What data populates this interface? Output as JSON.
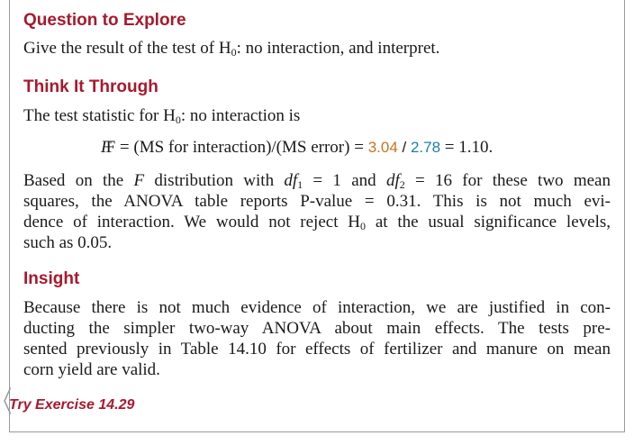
{
  "question": {
    "heading": "Question to Explore",
    "text_pre": "Give the result of the test of H",
    "text_sub": "0",
    "text_post": ": no interaction, and interpret."
  },
  "think": {
    "heading": "Think It Through",
    "intro_pre": "The test statistic for H",
    "intro_sub": "0",
    "intro_post": ": no interaction is",
    "formula_lhs": "F = (MS for interaction)/(MS error) = ",
    "ms_interaction": "3.04",
    "formula_slash": " / ",
    "ms_error": "2.78",
    "formula_result": " = 1.10.",
    "line1_pre": "Based on the ",
    "line1_F": "F",
    "line1_mid": " distribution with ",
    "df1_label": "df",
    "df1_sub": "1",
    "df1_val": " = 1 and ",
    "df2_label": "df",
    "df2_sub": "2",
    "df2_val": " = 16 for these two mean",
    "line2": "squares, the ANOVA table reports P-value = 0.31. This is not much evi-",
    "line3_pre": "dence of interaction. We would not reject H",
    "line3_sub": "0",
    "line3_post": " at the usual significance levels,",
    "line4": "such as 0.05."
  },
  "insight": {
    "heading": "Insight",
    "line1": "Because there is not much evidence of interaction, we are justified in con-",
    "line2": "ducting the simpler two-way ANOVA about main effects. The tests pre-",
    "line3": "sented previously in Table 14.10 for effects of fertilizer and manure on mean",
    "line4": "corn yield are valid."
  },
  "try_exercise": "Try Exercise 14.29",
  "colors": {
    "heading": "#a8192e",
    "ms_interaction": "#c7741f",
    "ms_error": "#1f7fa8",
    "border": "#9a9a9a"
  }
}
